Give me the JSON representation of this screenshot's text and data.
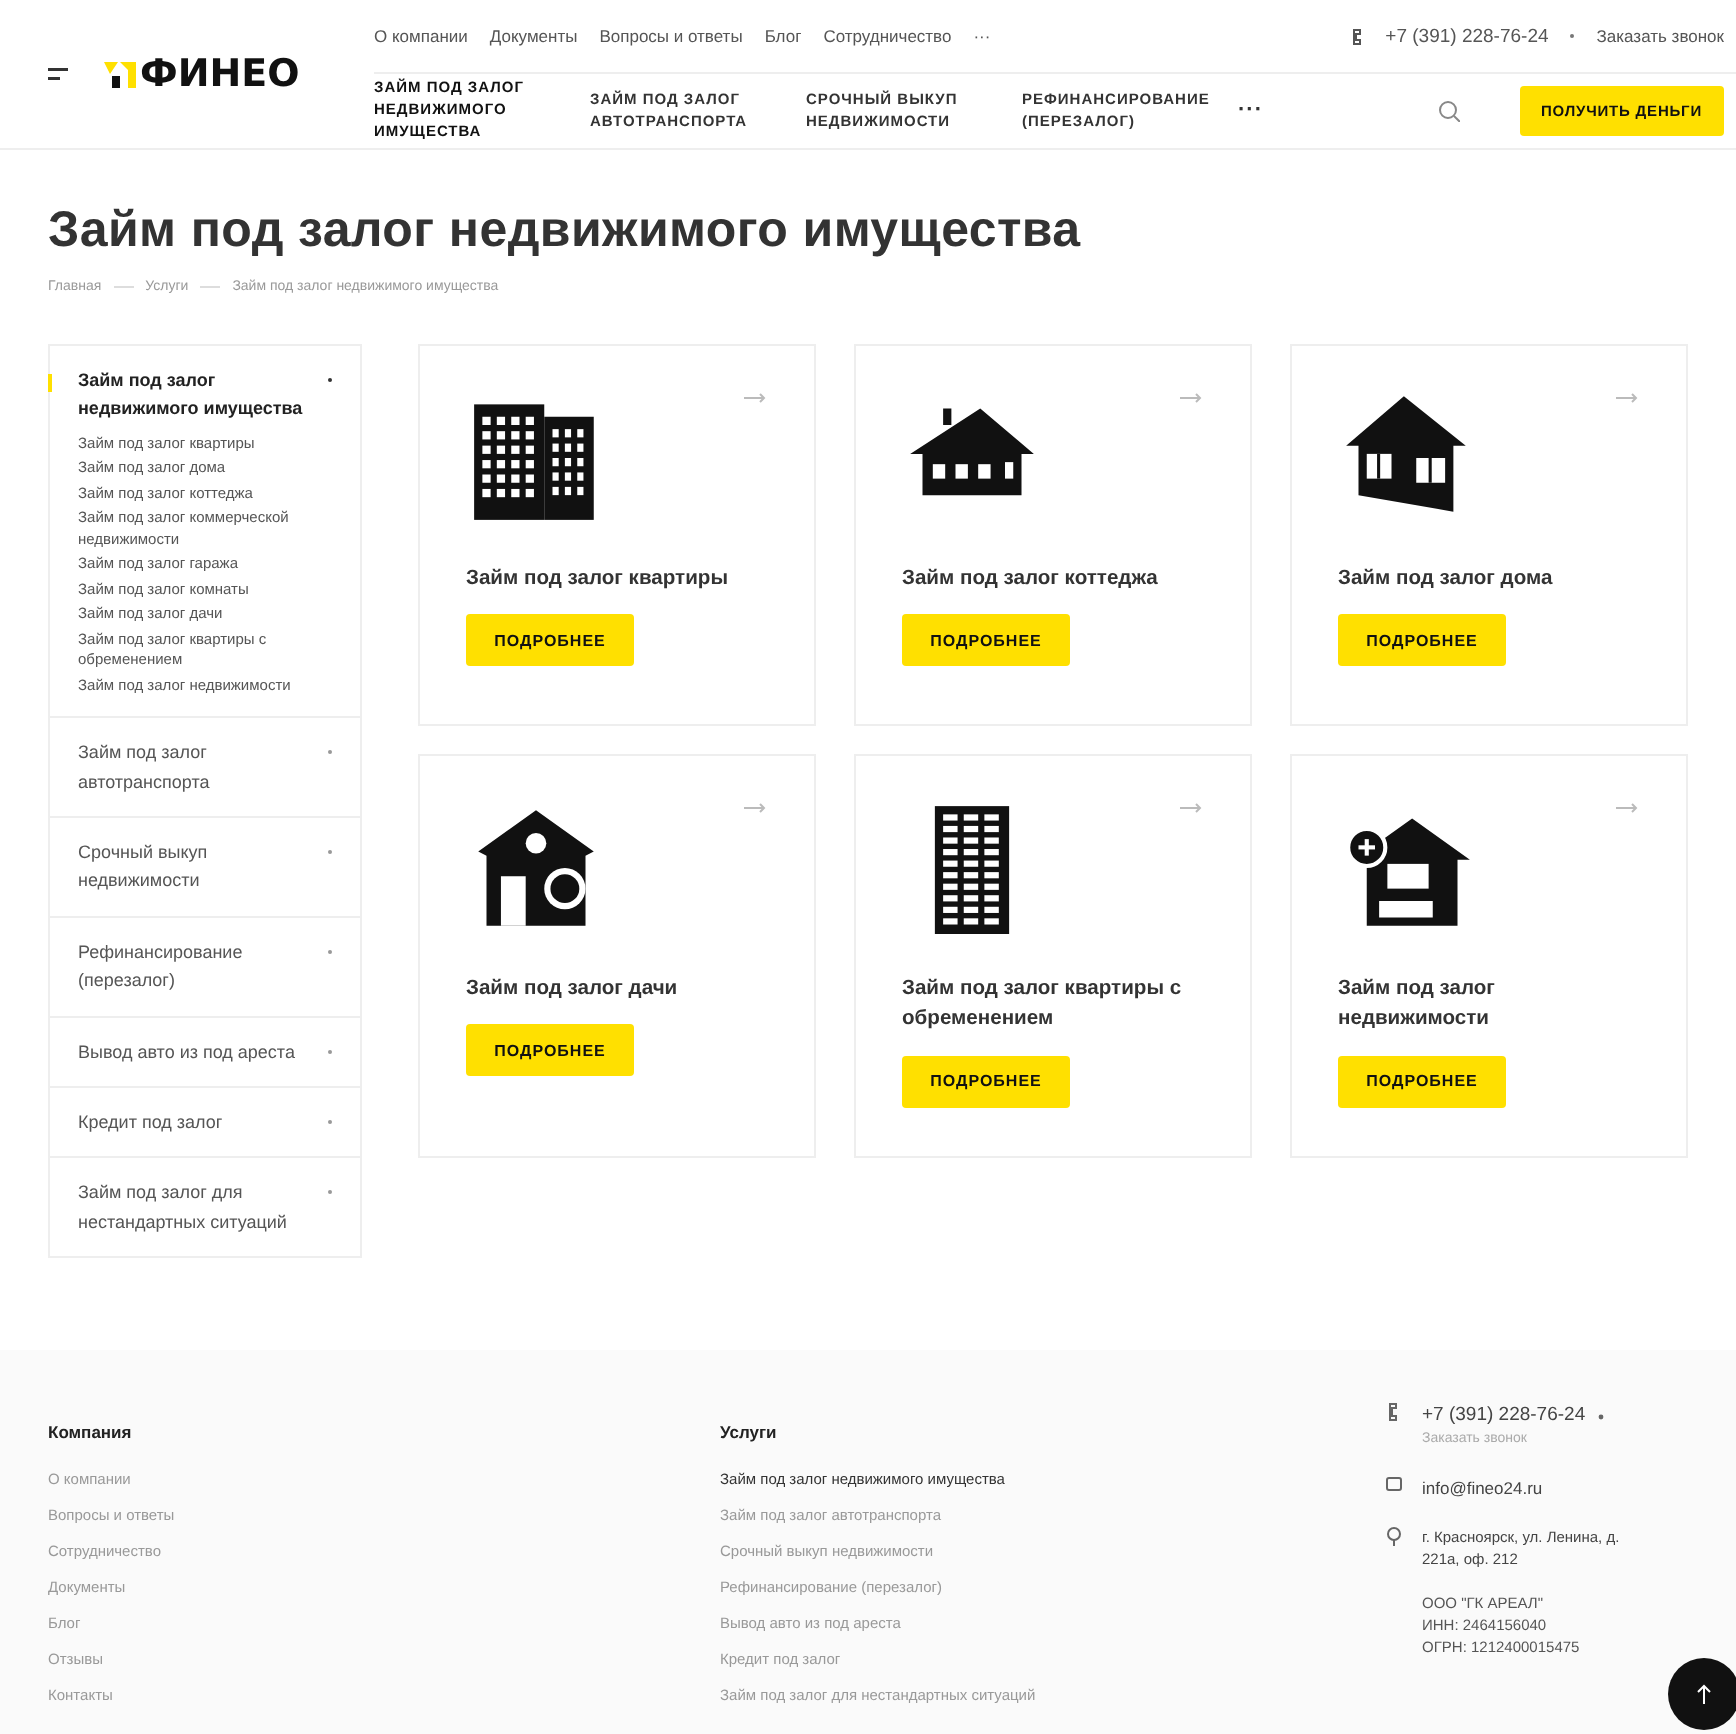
{
  "header": {
    "logo": "ФИНЕО",
    "top_links": [
      "О компании",
      "Документы",
      "Вопросы и ответы",
      "Блог",
      "Сотрудничество",
      "···"
    ],
    "phone": "+7 (391) 228-76-24",
    "callback": "Заказать звонок",
    "nav": [
      {
        "label": "ЗАЙМ ПОД ЗАЛОГ НЕДВИЖИМОГО ИМУЩЕСТВА",
        "selected": true
      },
      {
        "label": "ЗАЙМ ПОД ЗАЛОГ АВТОТРАНСПОРТА",
        "selected": false
      },
      {
        "label": "СРОЧНЫЙ ВЫКУП НЕДВИЖИМОСТИ",
        "selected": false
      },
      {
        "label": "РЕФИНАНСИРОВАНИЕ (ПЕРЕЗАЛОГ)",
        "selected": false
      }
    ],
    "nav_more": "···",
    "cta": "ПОЛУЧИТЬ ДЕНЬГИ"
  },
  "title": "Займ под залог недвижимого имущества",
  "breadcrumbs": [
    "Главная",
    "Услуги",
    "Займ под залог недвижимого имущества"
  ],
  "sidebar": {
    "items": [
      {
        "label": "Займ под залог недвижимого имущества",
        "selected": true,
        "expanded": true,
        "children": [
          {
            "label": "Займ под залог квартиры"
          },
          {
            "label": "Займ под залог дома"
          },
          {
            "label": "Займ под залог коттеджа"
          },
          {
            "label": "Займ под залог коммерческой недвижимости"
          },
          {
            "label": "Займ под залог гаража"
          },
          {
            "label": "Займ под залог комнаты"
          },
          {
            "label": "Займ под залог дачи"
          },
          {
            "label": "Займ под залог квартиры с обременением"
          },
          {
            "label": "Займ под залог недвижимости"
          }
        ]
      },
      {
        "label": "Займ под залог автотранспорта",
        "selected": false,
        "expanded": false
      },
      {
        "label": "Срочный выкуп недвижимости",
        "selected": false,
        "expanded": false
      },
      {
        "label": "Рефинансирование (перезалог)",
        "selected": false,
        "expanded": false
      },
      {
        "label": "Вывод авто из под ареста",
        "selected": false,
        "expanded": false
      },
      {
        "label": "Кредит под залог",
        "selected": false,
        "expanded": false
      },
      {
        "label": "Займ под залог для нестандартных ситуаций",
        "selected": false,
        "expanded": false
      }
    ]
  },
  "cards": [
    {
      "kind": "apartments",
      "title": "Займ под залог квартиры",
      "button": "ПОДРОБНЕЕ"
    },
    {
      "kind": "cottage",
      "title": "Займ под залог коттеджа",
      "button": "ПОДРОБНЕЕ"
    },
    {
      "kind": "house",
      "title": "Займ под залог дома",
      "button": "ПОДРОБНЕЕ"
    },
    {
      "kind": "dacha",
      "title": "Займ под залог дачи",
      "button": "ПОДРОБНЕЕ"
    },
    {
      "kind": "tower",
      "title": "Займ под залог квартиры с обременением",
      "button": "ПОДРОБНЕЕ"
    },
    {
      "kind": "property",
      "title": "Займ под залог недвижимости",
      "button": "ПОДРОБНЕЕ"
    }
  ],
  "footer": {
    "company": {
      "heading": "Компания",
      "links": [
        "О компании",
        "Вопросы и ответы",
        "Сотрудничество",
        "Документы",
        "Блог",
        "Отзывы",
        "Контакты"
      ]
    },
    "services": {
      "heading": "Услуги",
      "links": [
        {
          "label": "Займ под залог недвижимого имущества",
          "selected": true
        },
        {
          "label": "Займ под залог автотранспорта",
          "selected": false
        },
        {
          "label": "Срочный выкуп недвижимости",
          "selected": false
        },
        {
          "label": "Рефинансирование (перезалог)",
          "selected": false
        },
        {
          "label": "Вывод авто из под ареста",
          "selected": false
        },
        {
          "label": "Кредит под залог",
          "selected": false
        },
        {
          "label": "Займ под залог для нестандартных ситуаций",
          "selected": false
        }
      ]
    },
    "contacts": {
      "phone": "+7 (391) 228-76-24",
      "callback": "Заказать звонок",
      "email": "info@fineo24.ru",
      "address": "г. Красноярск, ул. Ленина, д. 221а, оф. 212",
      "legal": [
        "ООО \"ГК АРЕАЛ\"",
        "ИНН: 2464156040",
        "ОГРН: 1212400015475"
      ]
    }
  }
}
